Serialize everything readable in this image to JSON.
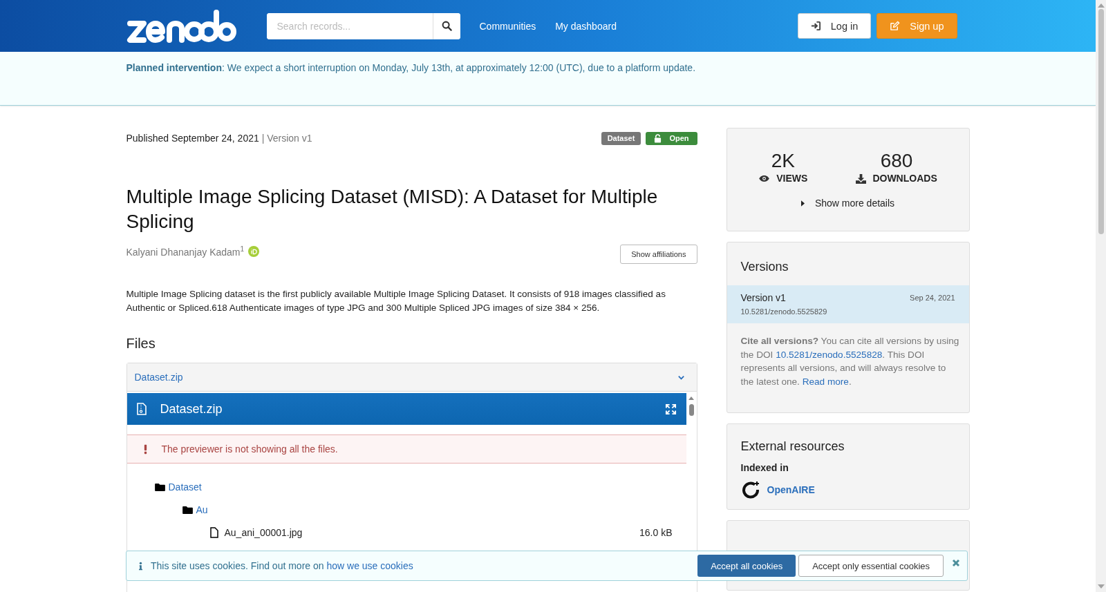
{
  "header": {
    "search": {
      "placeholder": "Search records..."
    },
    "nav": [
      "Communities",
      "My dashboard"
    ],
    "login": "Log in",
    "signup": "Sign up"
  },
  "notice": {
    "title": "Planned intervention",
    "text": ": We expect a short interruption on Monday, July 13th, at approximately 12:00 (UTC), due to a platform update."
  },
  "record": {
    "published": "Published September 24, 2021",
    "version": "| Version v1",
    "badges": [
      {
        "kind": "type",
        "label": "Dataset"
      },
      {
        "kind": "access",
        "label": "Open"
      }
    ],
    "title": "Multiple Image Splicing Dataset (MISD): A Dataset for Multiple Splicing",
    "creators": [
      {
        "name": "Kalyani Dhananjay Kadam",
        "affiliation": "1",
        "orcid": true
      }
    ],
    "show_affiliations": "Show affiliations",
    "description": "Multiple Image Splicing dataset is the first publicly available Multiple Image Splicing Dataset. It consists of 918 images classified as Authentic or Spliced.618 Authenticate images of type JPG and 300 Multiple Spliced JPG images of size 384 × 256."
  },
  "files": {
    "heading": "Files",
    "accordion": {
      "title": "Dataset.zip",
      "expanded": true
    },
    "preview": {
      "title": "Dataset.zip",
      "warning": "The previewer is not showing all the files.",
      "tree": [
        {
          "kind": "folder",
          "name": "Dataset",
          "children": [
            {
              "kind": "folder",
              "name": "Au",
              "children": [
                {
                  "kind": "file",
                  "name": "Au_ani_00001.jpg",
                  "size": "16.0 kB"
                }
              ]
            }
          ]
        }
      ]
    }
  },
  "sidebar": {
    "stats": [
      {
        "kind": "views",
        "value": "2K",
        "label": "VIEWS"
      },
      {
        "kind": "downloads",
        "value": "680",
        "label": "DOWNLOADS"
      }
    ],
    "more_details": "Show more details",
    "versions": {
      "title": "Versions",
      "items": [
        {
          "label": "Version v1",
          "date": "Sep 24, 2021",
          "doi": "10.5281/zenodo.5525829",
          "selected": true
        }
      ],
      "cite": {
        "question": "Cite all versions?",
        "text1": " You can cite all versions by using the DOI ",
        "doi": "10.5281/zenodo.5525828",
        "text2": ". This DOI represents all versions, and will always resolve to the latest one. ",
        "read_more": "Read more",
        "end": "."
      }
    },
    "external": {
      "title": "External resources",
      "subtitle": "Indexed in",
      "items": [
        {
          "name": "OpenAIRE"
        }
      ]
    }
  },
  "cookies": {
    "text": "This site uses cookies. Find out more on ",
    "link": "how we use cookies",
    "accept_all": "Accept all cookies",
    "accept_essential": "Accept only essential cookies"
  }
}
